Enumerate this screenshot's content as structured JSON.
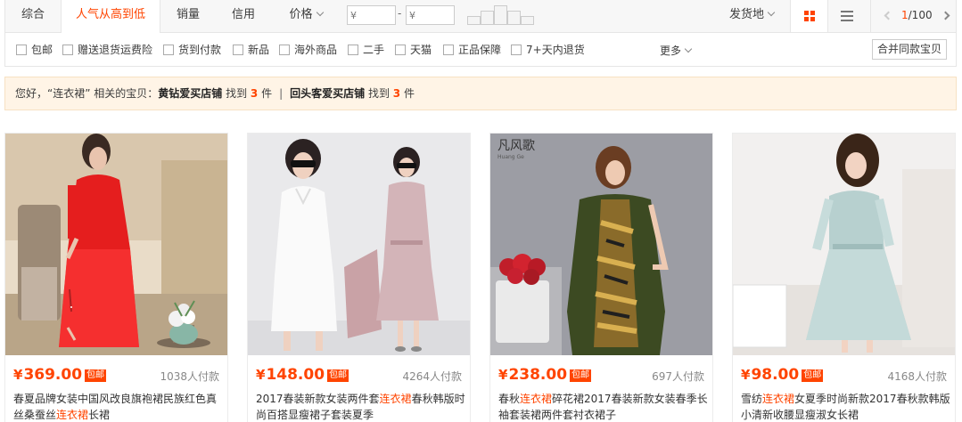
{
  "sort_tabs": [
    {
      "label": "综合"
    },
    {
      "label": "人气从高到低"
    },
    {
      "label": "销量"
    },
    {
      "label": "信用"
    },
    {
      "label": "价格"
    }
  ],
  "price_filter": {
    "min_placeholder": "¥",
    "max_placeholder": "¥",
    "separator": "-"
  },
  "location_label": "发货地",
  "pager": {
    "current": "1",
    "total": "/100"
  },
  "filters": [
    "包邮",
    "赠送退货运费险",
    "货到付款",
    "新品",
    "海外商品",
    "二手",
    "天猫",
    "正品保障",
    "7+天内退货"
  ],
  "more_label": "更多",
  "merge_label": "合并同款宝贝",
  "notice": {
    "prefix": "您好，“连衣裙” 相关的宝贝：",
    "shop1": "黄钻爱买店铺",
    "found1": " 找到 ",
    "count1": "3",
    "unit1": " 件",
    "divider": "|",
    "shop2": "回头客爱买店铺",
    "found2": " 找到 ",
    "count2": "3",
    "unit2": " 件"
  },
  "items": [
    {
      "price": "369.00",
      "badge": "包邮",
      "buyers": "1038人付款",
      "title_a": "春夏品牌女装中国风改良旗袍裙民族红色真丝桑蚕丝",
      "title_hl": "连衣裙",
      "title_b": "长裙"
    },
    {
      "price": "148.00",
      "badge": "包邮",
      "buyers": "4264人付款",
      "title_a": "2017春装新款女装两件套",
      "title_hl": "连衣裙",
      "title_b": "春秋韩版时尚百搭显瘦裙子套装夏季"
    },
    {
      "price": "238.00",
      "badge": "包邮",
      "buyers": "697人付款",
      "title_a": "春秋",
      "title_hl": "连衣裙",
      "title_b": "碎花裙2017春装新款女装春季长袖套装裙两件套衬衣裙子"
    },
    {
      "price": "98.00",
      "badge": "包邮",
      "buyers": "4168人付款",
      "title_a": "雪纺",
      "title_hl": "连衣裙",
      "title_b": "女夏季时尚新款2017春秋款韩版小清新收腰显瘦淑女长裙"
    }
  ],
  "item3_logo": "凡风歌",
  "currency": "¥",
  "colors": {
    "accent": "#ff4400",
    "notice_bg": "#fff4e6"
  }
}
